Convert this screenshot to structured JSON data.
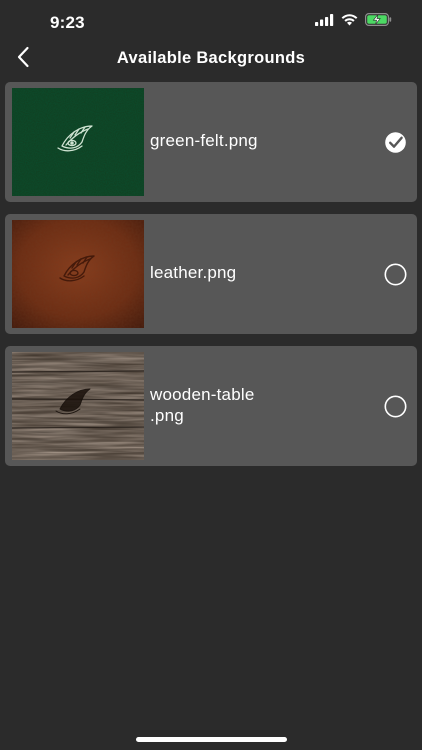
{
  "status_bar": {
    "time": "9:23"
  },
  "nav": {
    "title": "Available Backgrounds",
    "back_icon": "chevron-left-icon"
  },
  "backgrounds": [
    {
      "label": "green-felt.png",
      "selected": true,
      "texture": "green-felt"
    },
    {
      "label": "leather.png",
      "selected": false,
      "texture": "leather"
    },
    {
      "label": "wooden-table\n.png",
      "selected": false,
      "texture": "wooden-table"
    }
  ],
  "colors": {
    "background": "#2b2b2b",
    "row": "#575757",
    "text": "#ffffff",
    "battery_fill": "#4cd964"
  }
}
